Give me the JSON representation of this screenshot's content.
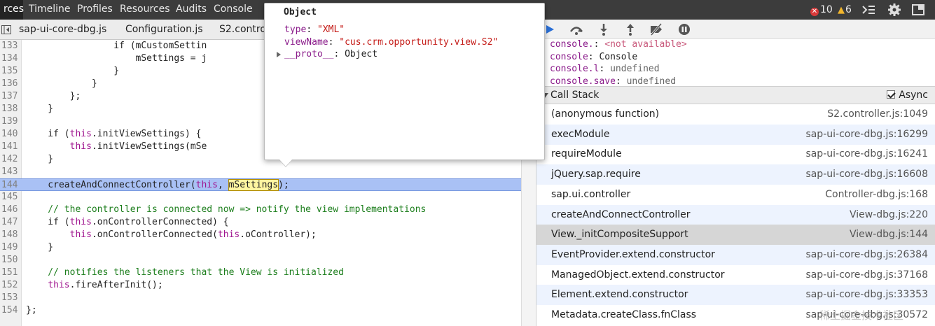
{
  "toolbar": {
    "tabs": [
      {
        "label": "rces",
        "active": true
      },
      {
        "label": "Timeline",
        "active": false
      },
      {
        "label": "Profiles",
        "active": false
      },
      {
        "label": "Resources",
        "active": false
      },
      {
        "label": "Audits",
        "active": false
      },
      {
        "label": "Console",
        "active": false
      }
    ],
    "error_count": "10",
    "warning_count": "6",
    "icons": [
      "error-icon",
      "warning-icon",
      "console-drawer-icon",
      "settings-gear-icon",
      "dock-icon"
    ]
  },
  "file_tabs": [
    {
      "label": "sap-ui-core-dbg.js"
    },
    {
      "label": "Configuration.js"
    },
    {
      "label": "S2.contro"
    }
  ],
  "editor": {
    "lines": [
      {
        "n": "133",
        "parts": [
          {
            "t": "                if (mCustomSettin",
            "c": ""
          }
        ]
      },
      {
        "n": "134",
        "parts": [
          {
            "t": "                    mSettings = j",
            "c": ""
          }
        ]
      },
      {
        "n": "135",
        "parts": [
          {
            "t": "                }",
            "c": ""
          }
        ]
      },
      {
        "n": "136",
        "parts": [
          {
            "t": "            }",
            "c": ""
          }
        ]
      },
      {
        "n": "137",
        "parts": [
          {
            "t": "        };",
            "c": ""
          }
        ]
      },
      {
        "n": "138",
        "parts": [
          {
            "t": "    }",
            "c": ""
          }
        ]
      },
      {
        "n": "139",
        "parts": [
          {
            "t": "",
            "c": ""
          }
        ]
      },
      {
        "n": "140",
        "parts": [
          {
            "t": "    if (",
            "c": ""
          },
          {
            "t": "this",
            "c": "kw"
          },
          {
            "t": ".initViewSettings) {",
            "c": ""
          }
        ]
      },
      {
        "n": "141",
        "parts": [
          {
            "t": "        ",
            "c": ""
          },
          {
            "t": "this",
            "c": "kw"
          },
          {
            "t": ".initViewSettings(mSe",
            "c": ""
          }
        ]
      },
      {
        "n": "142",
        "parts": [
          {
            "t": "    }",
            "c": ""
          }
        ]
      },
      {
        "n": "143",
        "parts": [
          {
            "t": "",
            "c": ""
          }
        ]
      },
      {
        "n": "144",
        "hl": true,
        "parts": [
          {
            "t": "    createAndConnectController(",
            "c": ""
          },
          {
            "t": "this",
            "c": "kw"
          },
          {
            "t": ", ",
            "c": ""
          },
          {
            "t": "mSettings",
            "c": "word-hl"
          },
          {
            "t": ");",
            "c": ""
          }
        ]
      },
      {
        "n": "145",
        "parts": [
          {
            "t": "",
            "c": ""
          }
        ]
      },
      {
        "n": "146",
        "parts": [
          {
            "t": "    // the controller is connected now => notify the view implementations",
            "c": "cm"
          }
        ]
      },
      {
        "n": "147",
        "parts": [
          {
            "t": "    if (",
            "c": ""
          },
          {
            "t": "this",
            "c": "kw"
          },
          {
            "t": ".onControllerConnected) {",
            "c": ""
          }
        ]
      },
      {
        "n": "148",
        "parts": [
          {
            "t": "        ",
            "c": ""
          },
          {
            "t": "this",
            "c": "kw"
          },
          {
            "t": ".onControllerConnected(",
            "c": ""
          },
          {
            "t": "this",
            "c": "kw"
          },
          {
            "t": ".oController);",
            "c": ""
          }
        ]
      },
      {
        "n": "149",
        "parts": [
          {
            "t": "    }",
            "c": ""
          }
        ]
      },
      {
        "n": "150",
        "parts": [
          {
            "t": "",
            "c": ""
          }
        ]
      },
      {
        "n": "151",
        "parts": [
          {
            "t": "    // notifies the listeners that the View is initialized",
            "c": "cm"
          }
        ]
      },
      {
        "n": "152",
        "parts": [
          {
            "t": "    ",
            "c": ""
          },
          {
            "t": "this",
            "c": "kw"
          },
          {
            "t": ".fireAfterInit();",
            "c": ""
          }
        ]
      },
      {
        "n": "153",
        "parts": [
          {
            "t": "",
            "c": ""
          }
        ]
      },
      {
        "n": "154",
        "parts": [
          {
            "t": "};",
            "c": ""
          }
        ]
      }
    ]
  },
  "popover": {
    "title": "Object",
    "rows": [
      {
        "key": "type",
        "sep": ": ",
        "value": "\"XML\"",
        "kind": "str"
      },
      {
        "key": "viewName",
        "sep": ": ",
        "value": "\"cus.crm.opportunity.view.S2\"",
        "kind": "str"
      },
      {
        "key": "__proto__",
        "sep": ": ",
        "value": "Object",
        "kind": "obj"
      }
    ]
  },
  "watch": [
    {
      "key": "console.",
      "sep": ": ",
      "value": "<not available>",
      "kind": "na"
    },
    {
      "key": "console",
      "sep": ": ",
      "value": "Console",
      "kind": "pv"
    },
    {
      "key": "console.l",
      "sep": ": ",
      "value": "undefined",
      "kind": "un"
    },
    {
      "key": "console.save",
      "sep": ": ",
      "value": "undefined",
      "kind": "un"
    }
  ],
  "call_stack": {
    "title": "Call Stack",
    "async_label": "Async",
    "async_checked": true,
    "frames": [
      {
        "fn": "(anonymous function)",
        "loc": "S2.controller.js:1049"
      },
      {
        "fn": "execModule",
        "loc": "sap-ui-core-dbg.js:16299"
      },
      {
        "fn": "requireModule",
        "loc": "sap-ui-core-dbg.js:16241"
      },
      {
        "fn": "jQuery.sap.require",
        "loc": "sap-ui-core-dbg.js:16608"
      },
      {
        "fn": "sap.ui.controller",
        "loc": "Controller-dbg.js:168"
      },
      {
        "fn": "createAndConnectController",
        "loc": "View-dbg.js:220"
      },
      {
        "fn": "View._initCompositeSupport",
        "loc": "View-dbg.js:144",
        "selected": true
      },
      {
        "fn": "EventProvider.extend.constructor",
        "loc": "sap-ui-core-dbg.js:26384"
      },
      {
        "fn": "ManagedObject.extend.constructor",
        "loc": "sap-ui-core-dbg.js:37168"
      },
      {
        "fn": "Element.extend.constructor",
        "loc": "sap-ui-core-dbg.js:33353"
      },
      {
        "fn": "Metadata.createClass.fnClass",
        "loc": "sap-ui-core-dbg.js:30572"
      }
    ]
  },
  "watermark": "稀土掘金技术社区",
  "debugger_controls": [
    "resume-icon",
    "step-over-icon",
    "step-into-icon",
    "step-out-icon",
    "deactivate-breakpoints-icon",
    "pause-on-exceptions-icon"
  ]
}
